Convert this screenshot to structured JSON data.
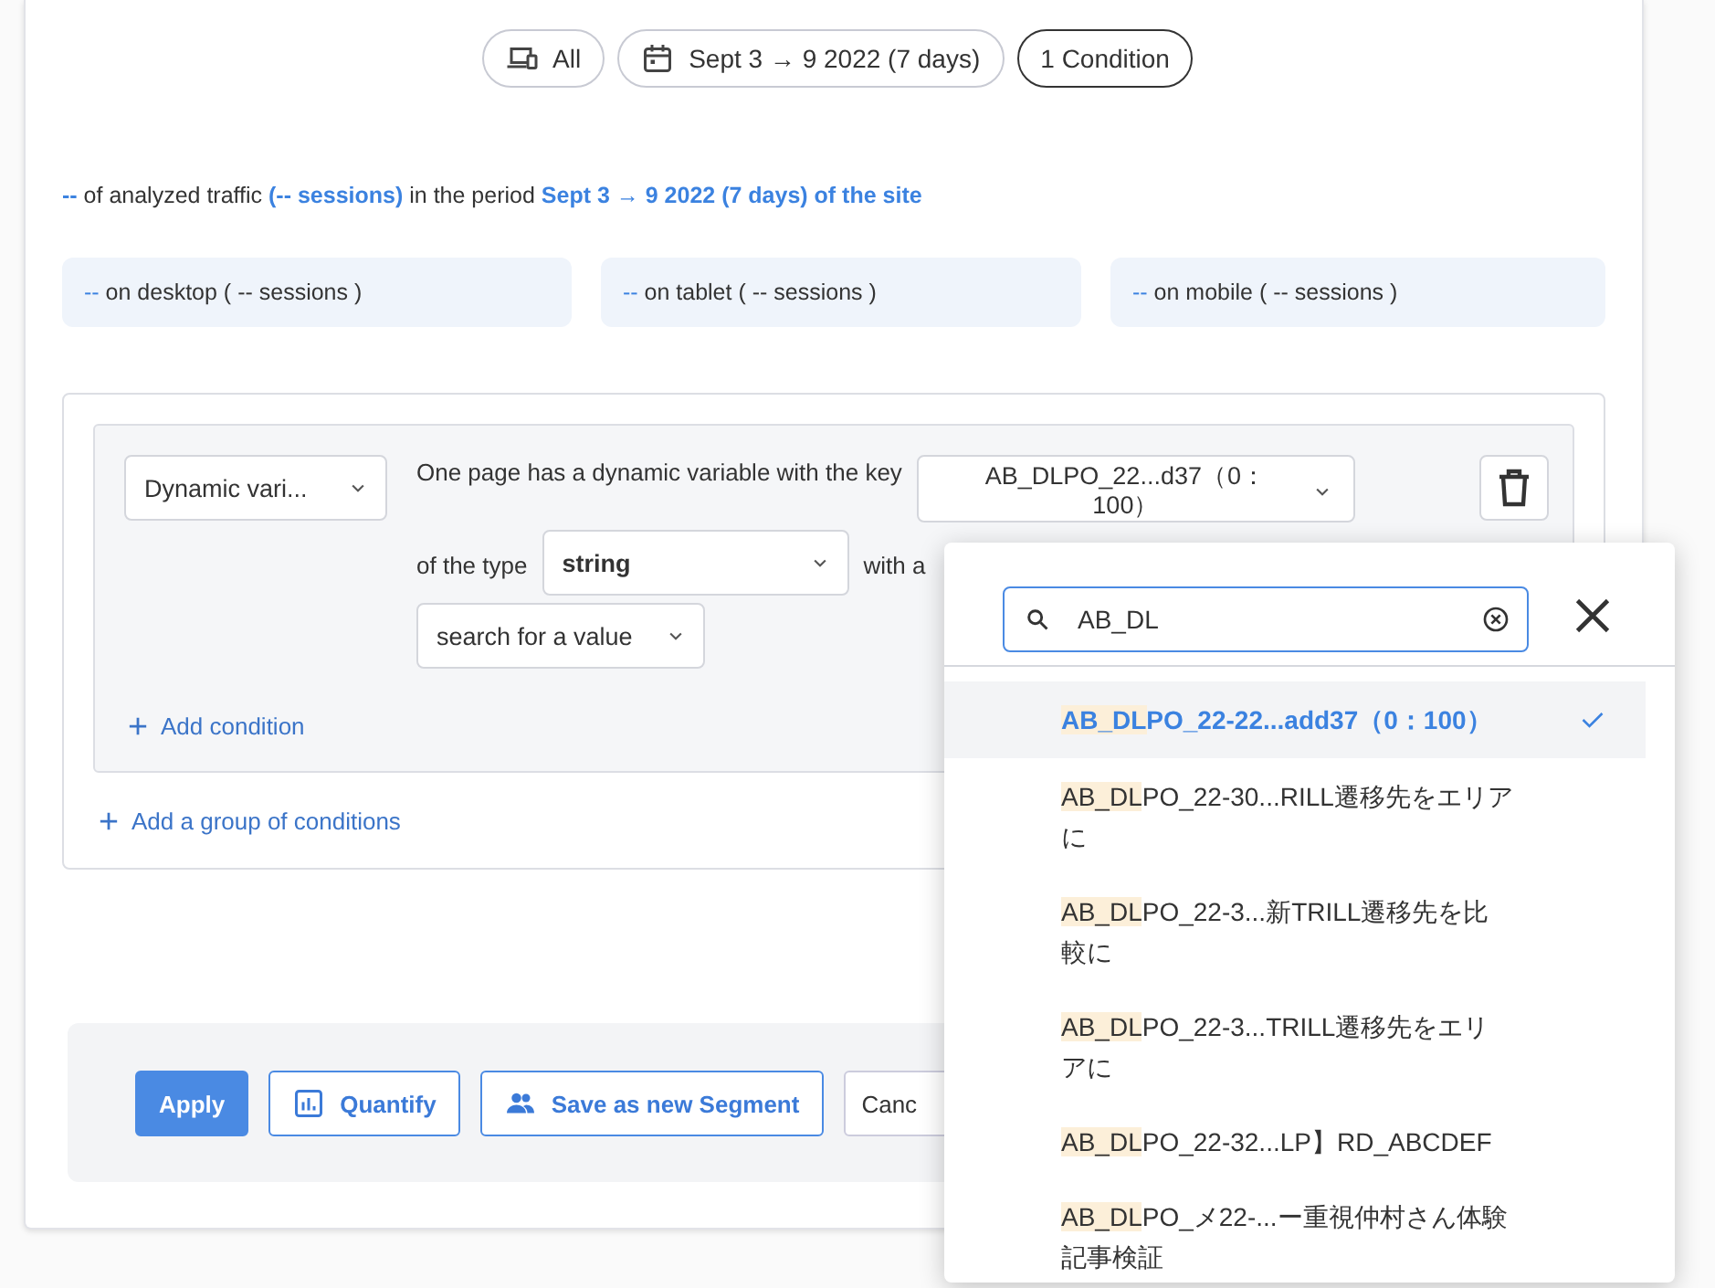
{
  "filters": [
    {
      "kind": "device",
      "label": "All",
      "selected": false
    },
    {
      "kind": "date",
      "label": "Sept 3 → 9 2022 (7 days)",
      "selected": false
    },
    {
      "kind": "plain",
      "label": "1 Condition",
      "selected": true
    }
  ],
  "summary": "**--** of analyzed traffic **(-- sessions)** in the period **Sept 3 → 9 2022 (7 days) of the site**",
  "tiles": [
    {
      "value": "--",
      "label": " on desktop ( -- sessions )"
    },
    {
      "value": "--",
      "label": " on tablet ( -- sessions )"
    },
    {
      "value": "--",
      "label": " on mobile ( -- sessions )"
    }
  ],
  "condition": {
    "field_select": "Dynamic vari...",
    "sentence": "One page has a dynamic variable with the key",
    "key_select": "AB_DLPO_22...d37（0：100）",
    "type_label": "of the type",
    "type_select": "string",
    "with_label": "with a",
    "operator_select": "search for a value",
    "add_condition": "Add condition"
  },
  "add_group": "Add a group of conditions",
  "actions": [
    {
      "kind": "primary",
      "label": "Apply"
    },
    {
      "kind": "quantify",
      "label": "Quantify"
    },
    {
      "kind": "segment",
      "label": "Save as new Segment"
    },
    {
      "kind": "plain",
      "label": "Canc"
    }
  ],
  "popup": {
    "search": "AB_DL",
    "options": [
      {
        "match": "AB_DL",
        "rest": "PO_22-22...add37（0：100）",
        "selected": true
      },
      {
        "match": "AB_DL",
        "rest": "PO_22-30...RILL遷移先をエリアに",
        "selected": false
      },
      {
        "match": "AB_DL",
        "rest": "PO_22-3...新TRILL遷移先を比較に",
        "selected": false
      },
      {
        "match": "AB_DL",
        "rest": "PO_22-3...TRILL遷移先をエリアに",
        "selected": false
      },
      {
        "match": "AB_DL",
        "rest": "PO_22-32...LP】RD_ABCDEF",
        "selected": false
      },
      {
        "match": "AB_DL",
        "rest": "PO_メ22-...ー重視仲村さん体験記事検証",
        "selected": false
      }
    ]
  }
}
